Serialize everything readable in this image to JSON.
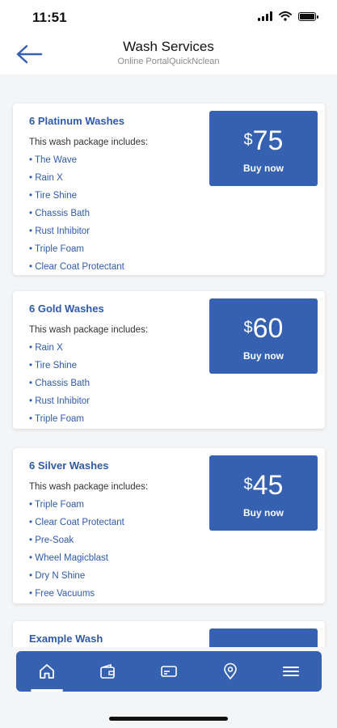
{
  "status": {
    "time": "11:51"
  },
  "header": {
    "title": "Wash Services",
    "subtitle": "Online PortalQuickNclean"
  },
  "packages": [
    {
      "title": "6 Platinum Washes",
      "intro": "This wash package includes:",
      "features": [
        "The Wave",
        "Rain X",
        "Tire Shine",
        "Chassis Bath",
        "Rust Inhibitor",
        "Triple Foam",
        "Clear Coat Protectant"
      ],
      "currency": "$",
      "price": "75",
      "button": "Buy now"
    },
    {
      "title": "6 Gold Washes",
      "intro": "This wash package includes:",
      "features": [
        "Rain X",
        "Tire Shine",
        "Chassis Bath",
        "Rust Inhibitor",
        "Triple Foam"
      ],
      "currency": "$",
      "price": "60",
      "button": "Buy now"
    },
    {
      "title": "6 Silver Washes",
      "intro": "This wash package includes:",
      "features": [
        "Triple Foam",
        "Clear Coat Protectant",
        "Pre-Soak",
        "Wheel Magicblast",
        "Dry N Shine",
        "Free Vacuums"
      ],
      "currency": "$",
      "price": "45",
      "button": "Buy now"
    },
    {
      "title": "Example Wash"
    }
  ],
  "tabs": [
    {
      "icon": "home-icon",
      "active": true
    },
    {
      "icon": "wallet-icon",
      "active": false
    },
    {
      "icon": "card-icon",
      "active": false
    },
    {
      "icon": "location-pin-icon",
      "active": false
    },
    {
      "icon": "menu-icon",
      "active": false
    }
  ],
  "colors": {
    "accent": "#3561b0",
    "title": "#2f5aa8",
    "background": "#f4f5f7"
  }
}
